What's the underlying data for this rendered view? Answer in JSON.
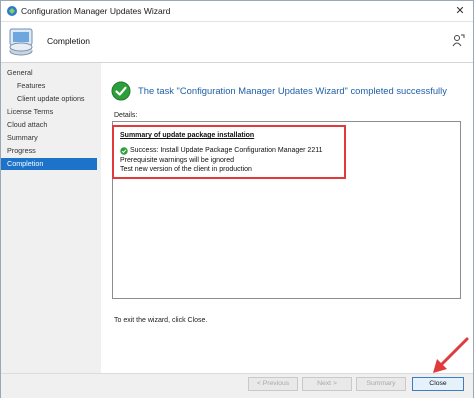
{
  "window": {
    "title": "Configuration Manager Updates Wizard",
    "close_glyph": "✕"
  },
  "header": {
    "title": "Completion",
    "icon": "computer-drive-icon",
    "help_icon": "help-person-icon"
  },
  "nav": {
    "items": [
      {
        "label": "General",
        "sub": false,
        "active": false
      },
      {
        "label": "Features",
        "sub": true,
        "active": false
      },
      {
        "label": "Client update options",
        "sub": true,
        "active": false
      },
      {
        "label": "License Terms",
        "sub": false,
        "active": false
      },
      {
        "label": "Cloud attach",
        "sub": false,
        "active": false
      },
      {
        "label": "Summary",
        "sub": false,
        "active": false
      },
      {
        "label": "Progress",
        "sub": false,
        "active": false
      },
      {
        "label": "Completion",
        "sub": false,
        "active": true
      }
    ]
  },
  "main": {
    "status_message": "The task \"Configuration Manager Updates Wizard\" completed successfully",
    "details_label": "Details:",
    "summary_heading": "Summary of update package installation",
    "lines": [
      "Success: Install Update Package Configuration Manager 2211",
      "Prerequisite warnings will be ignored",
      "Test new version of the client in production"
    ],
    "exit_text": "To exit the wizard, click Close."
  },
  "buttons": {
    "previous": "< Previous",
    "next": "Next >",
    "summary": "Summary",
    "close": "Close"
  },
  "colors": {
    "accent": "#1c73c9",
    "annotation": "#e03a3a",
    "success": "#2e9e3a",
    "link_blue": "#1f5fa8"
  }
}
